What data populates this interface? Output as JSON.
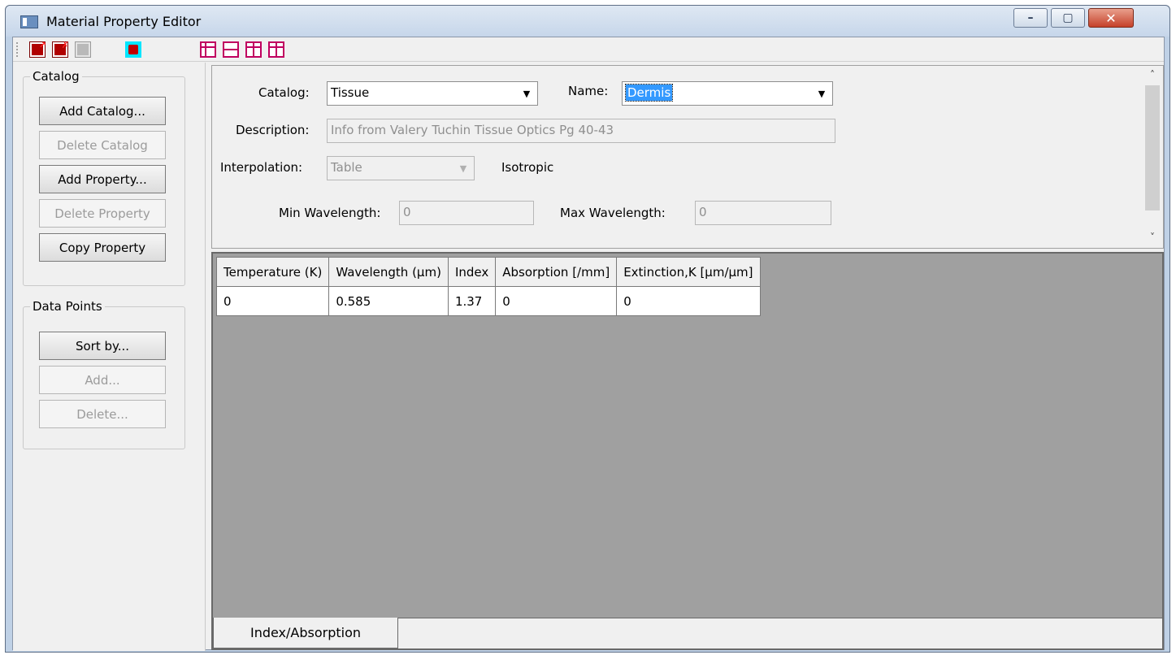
{
  "window": {
    "title": "Material Property Editor",
    "minimize": "–",
    "maximize": "▢",
    "close": "✕"
  },
  "toolbar": {
    "icons": [
      "open-icon",
      "save-as-icon",
      "save-icon",
      "lock-icon",
      "grid-insert-column-icon",
      "grid-insert-row-icon",
      "grid-move-down-icon",
      "grid-move-up-icon"
    ]
  },
  "catalog_group": {
    "title": "Catalog",
    "add_catalog": "Add Catalog...",
    "delete_catalog": "Delete Catalog",
    "add_property": "Add  Property...",
    "delete_property": "Delete Property",
    "copy_property": "Copy Property"
  },
  "data_points_group": {
    "title": "Data Points",
    "sort_by": "Sort by...",
    "add": "Add...",
    "delete": "Delete..."
  },
  "form": {
    "catalog_label": "Catalog:",
    "catalog_value": "Tissue",
    "name_label": "Name:",
    "name_value": "Dermis",
    "description_label": "Description:",
    "description_value": "Info from Valery Tuchin Tissue Optics Pg 40-43",
    "interpolation_label": "Interpolation:",
    "interpolation_value": "Table",
    "isotropic": "Isotropic",
    "min_wavelength_label": "Min Wavelength:",
    "min_wavelength_value": "0",
    "max_wavelength_label": "Max Wavelength:",
    "max_wavelength_value": "0"
  },
  "table": {
    "headers": [
      "Temperature (K)",
      "Wavelength (µm)",
      "Index",
      "Absorption [/mm]",
      "Extinction,K [µm/µm]"
    ],
    "rows": [
      [
        "0",
        "0.585",
        "1.37",
        "0",
        "0"
      ]
    ]
  },
  "tabs": {
    "active": "Index/Absorption"
  },
  "colors": {
    "selection": "#3399ff",
    "grid_background": "#a0a0a0",
    "close_button": "#c5412a"
  }
}
